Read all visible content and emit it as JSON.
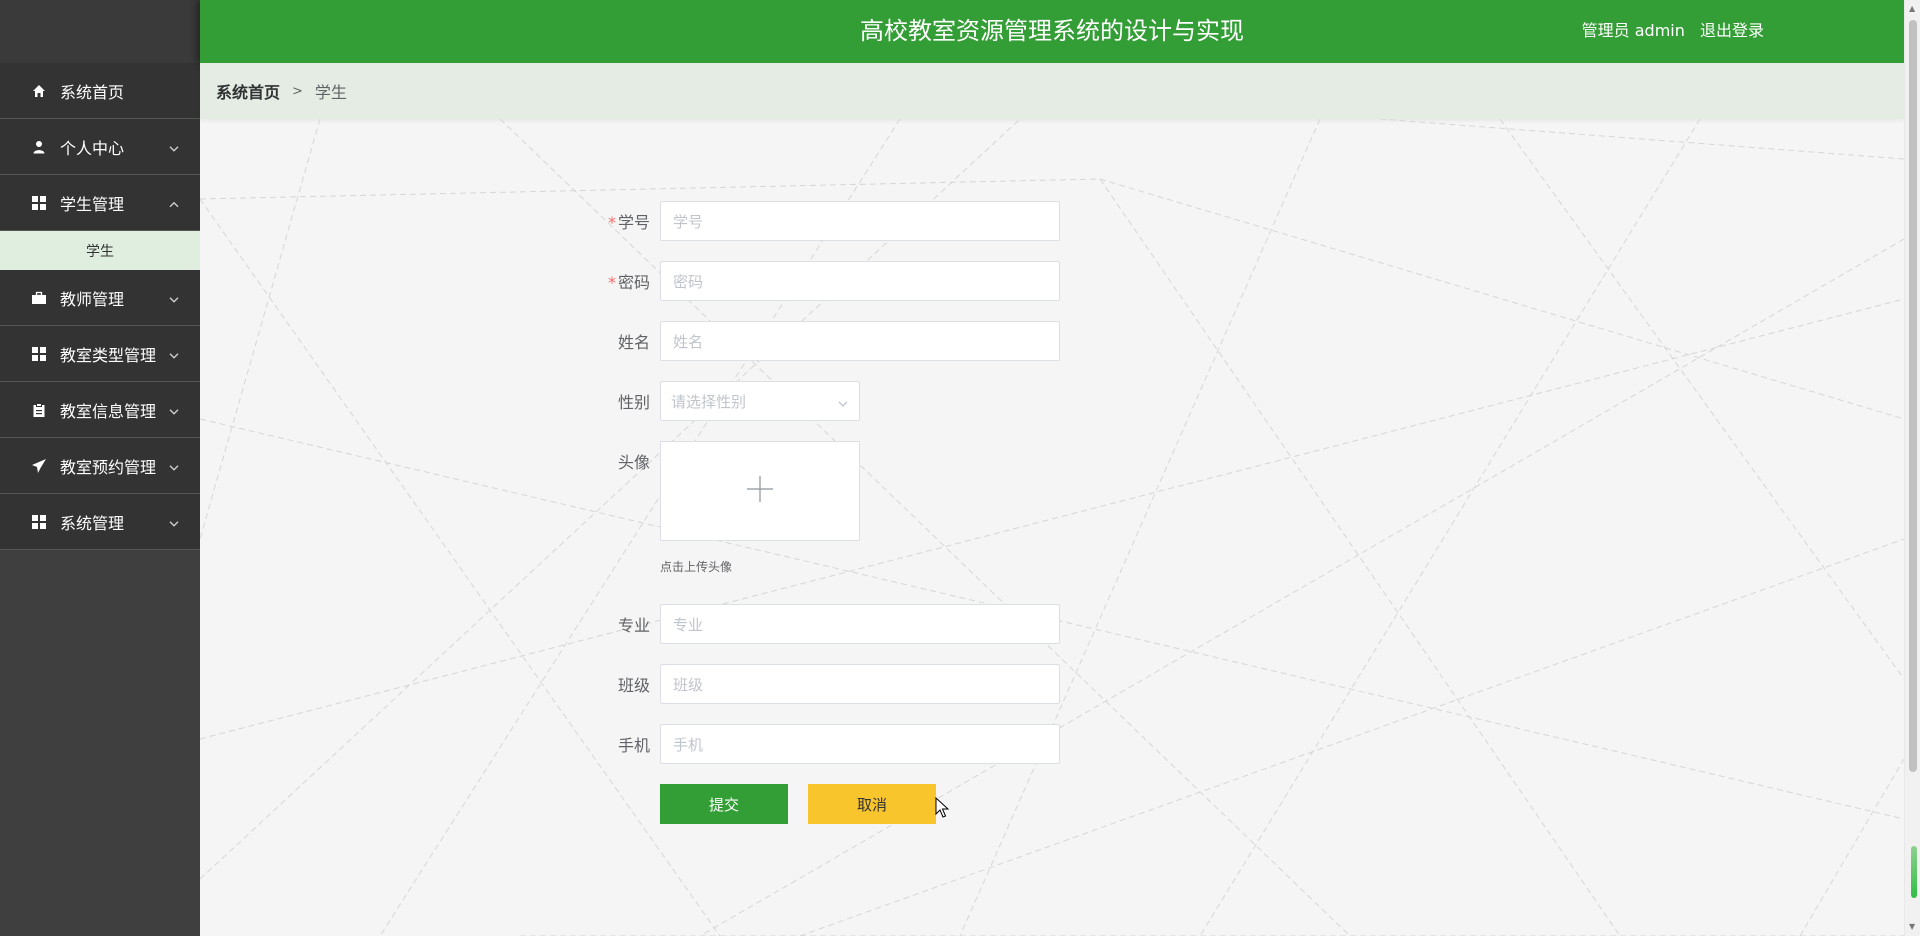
{
  "header": {
    "title": "高校教室资源管理系统的设计与实现",
    "user_label": "管理员 admin",
    "logout": "退出登录"
  },
  "sidebar": {
    "items": [
      {
        "label": "系统首页",
        "icon": "home-icon"
      },
      {
        "label": "个人中心",
        "icon": "user-icon"
      },
      {
        "label": "学生管理",
        "icon": "grid-icon",
        "expanded": true
      },
      {
        "label": "教师管理",
        "icon": "briefcase-icon"
      },
      {
        "label": "教室类型管理",
        "icon": "grid-icon"
      },
      {
        "label": "教室信息管理",
        "icon": "clipboard-icon"
      },
      {
        "label": "教室预约管理",
        "icon": "send-icon"
      },
      {
        "label": "系统管理",
        "icon": "grid-icon"
      }
    ],
    "submenu": {
      "label": "学生"
    }
  },
  "breadcrumb": {
    "home": "系统首页",
    "separator": ">",
    "current": "学生"
  },
  "form": {
    "student_id": {
      "label": "学号",
      "placeholder": "学号",
      "required": true
    },
    "password": {
      "label": "密码",
      "placeholder": "密码",
      "required": true
    },
    "name": {
      "label": "姓名",
      "placeholder": "姓名"
    },
    "gender": {
      "label": "性别",
      "placeholder": "请选择性别"
    },
    "avatar": {
      "label": "头像",
      "tip": "点击上传头像"
    },
    "major": {
      "label": "专业",
      "placeholder": "专业"
    },
    "class": {
      "label": "班级",
      "placeholder": "班级"
    },
    "phone": {
      "label": "手机",
      "placeholder": "手机"
    },
    "submit": "提交",
    "cancel": "取消",
    "required_mark": "*"
  },
  "colors": {
    "header_bg": "#349e36",
    "sidebar_bg": "#3f3f3f",
    "submit_bg": "#349e36",
    "cancel_bg": "#f8c52d",
    "required": "#f56c6c"
  }
}
